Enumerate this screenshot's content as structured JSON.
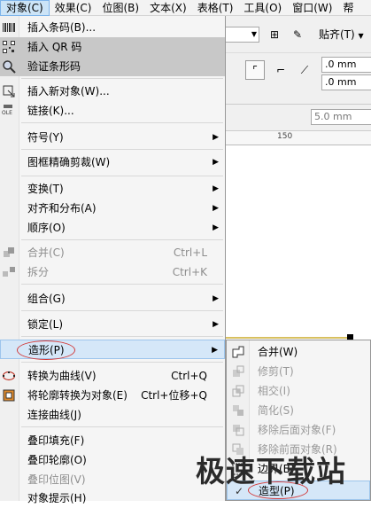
{
  "menubar": [
    "对象(C)",
    "效果(C)",
    "位图(B)",
    "文本(X)",
    "表格(T)",
    "工具(O)",
    "窗口(W)",
    "帮"
  ],
  "toolbar": {
    "snap_label": "贴齐(T)",
    "field1": ".0 mm",
    "field2": ".0 mm",
    "field3": "5.0 mm",
    "ruler_tick": "150"
  },
  "menu": {
    "barcode": "插入条码(B)...",
    "qr": "插入 QR 码",
    "verify": "验证条形码",
    "new_object": "插入新对象(W)...",
    "link": "链接(K)...",
    "symbol": "符号(Y)",
    "powerclip": "图框精确剪裁(W)",
    "transform": "变换(T)",
    "align": "对齐和分布(A)",
    "order": "顺序(O)",
    "combine": "合并(C)",
    "combine_sc": "Ctrl+L",
    "break": "拆分",
    "break_sc": "Ctrl+K",
    "group": "组合(G)",
    "lock": "锁定(L)",
    "shaping": "造形(P)",
    "to_curves": "转换为曲线(V)",
    "to_curves_sc": "Ctrl+Q",
    "outline_to_obj": "将轮廓转换为对象(E)",
    "outline_to_obj_sc": "Ctrl+位移+Q",
    "connect": "连接曲线(J)",
    "overprint_fill": "叠印填充(F)",
    "overprint_outline": "叠印轮廓(O)",
    "overprint_bitmap": "叠印位图(V)",
    "object_hints": "对象提示(H)"
  },
  "submenu": {
    "weld": "合并(W)",
    "trim": "修剪(T)",
    "intersect": "相交(I)",
    "simplify": "简化(S)",
    "front_minus_back": "移除后面对象(F)",
    "back_minus_front": "移除前面对象(R)",
    "boundary": "边界(B)",
    "shaping": "造型(P)"
  },
  "watermark": "极速下载站"
}
